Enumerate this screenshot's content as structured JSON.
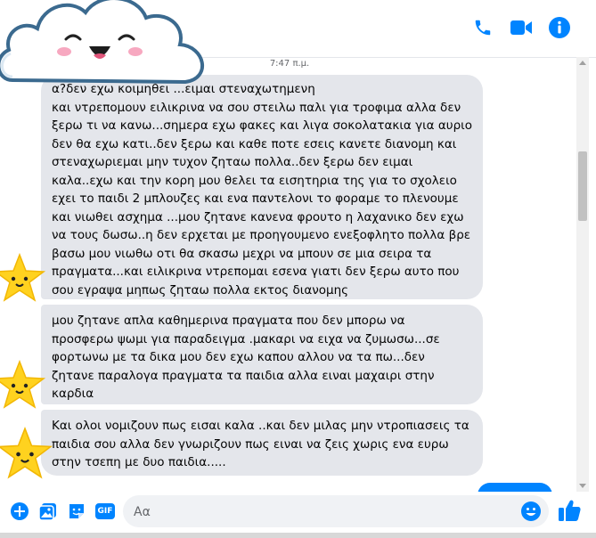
{
  "header": {
    "call_icon": "phone-icon",
    "video_icon": "video-camera-icon",
    "info_icon": "info-icon",
    "accent": "#0084ff"
  },
  "chat": {
    "timestamp": "7:47 π.μ.",
    "messages": [
      {
        "text": "α?δεν εχω κοιμηθει ...ειμαι στεναχωτημενη\nκαι ντρεπομουν ειλικρινα να σου στειλω παλι για τροφιμα αλλα δεν\nξερω τι να κανω...σημερα εχω φακες και λιγα σοκολατακια για αυριο\nδεν θα εχω κατι..δεν ξερω και καθε ποτε εσεις κανετε διανομη και\nστεναχωριεμαι μην τυχον ζηταω πολλα..δεν ξερω δεν ειμαι\nκαλα..εχω και την κορη μου θελει τα εισητηρια της για το σχολειο\nεχει το παιδι 2 μπλουζες και ενα παντελονι το φοραμε το πλενουμε\nκαι νιωθει ασχημα ...μου ζητανε κανενα φρουτο η λαχανικο δεν εχω\nνα τους δωσω..η δεν ερχεται με προηγουμενο ενεξοφλητο πολλα βρε\nβασω μου νιωθω οτι θα σκασω μεχρι να μπουν σε μια σειρα τα\nπραγματα...και ειλικρινα ντρεπομαι εσενα γιατι δεν ξερω αυτο που\nσου εγραψα μηπως ζηταω πολλα εκτος διανομης"
      },
      {
        "text": "μου ζητανε απλα καθημερινα πραγματα που δεν μπορω να\nπροσφερω ψωμι για παραδειγμα .μακαρι να ειχα να ζυμωσω...σε\nφορτωνω με τα δικα μου δεν εχω καπου αλλου να τα πω...δεν\nζητανε παραλογα πραγματα τα παιδια αλλα ειναι μαχαιρι στην\nκαρδια"
      },
      {
        "text": "Και ολοι νομιζουν πως εισαι καλα ..και δεν μιλας μην ντροπιασεις τα\nπαιδια σου αλλα δεν γνωριζουν πως ειναι να ζεις χωρις ενα ευρω\nστην τσεπη με δυο παιδια....."
      }
    ],
    "bubble_color": "#e4e6eb",
    "sticker_icon": "cloud-sticker-icon",
    "star_icon": "star-emoji-icon"
  },
  "composer": {
    "placeholder": "Αα",
    "tools": [
      "plus-icon",
      "image-icon",
      "sticker-icon",
      "gif-icon"
    ],
    "gif_label": "GIF",
    "emoji_icon": "emoji-icon",
    "like_icon": "thumbs-up-icon"
  }
}
